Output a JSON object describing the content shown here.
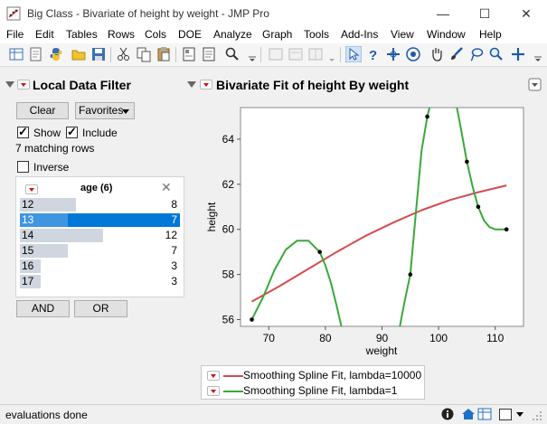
{
  "window": {
    "title": "Big Class - Bivariate of height by weight - JMP Pro"
  },
  "menu": [
    "File",
    "Edit",
    "Tables",
    "Rows",
    "Cols",
    "DOE",
    "Analyze",
    "Graph",
    "Tools",
    "Add-Ins",
    "View",
    "Window",
    "Help"
  ],
  "filter": {
    "header": "Local Data Filter",
    "clear_label": "Clear",
    "favorites_label": "Favorites",
    "show_label": "Show",
    "show_checked": true,
    "include_label": "Include",
    "include_checked": true,
    "matching": "7 matching rows",
    "inverse_label": "Inverse",
    "inverse_checked": false,
    "column_title": "age (6)",
    "rows": [
      {
        "label": "12",
        "count": "8",
        "fraction": 0.67,
        "selected": false
      },
      {
        "label": "13",
        "count": "7",
        "fraction": 0.58,
        "selected": true
      },
      {
        "label": "14",
        "count": "12",
        "fraction": 1.0,
        "selected": false
      },
      {
        "label": "15",
        "count": "7",
        "fraction": 0.58,
        "selected": false
      },
      {
        "label": "16",
        "count": "3",
        "fraction": 0.25,
        "selected": false
      },
      {
        "label": "17",
        "count": "3",
        "fraction": 0.25,
        "selected": false
      }
    ],
    "and_label": "AND",
    "or_label": "OR"
  },
  "report": {
    "header": "Bivariate Fit of height By weight"
  },
  "chart_data": {
    "type": "scatter",
    "xlabel": "weight",
    "ylabel": "height",
    "xlim": [
      65,
      115
    ],
    "ylim": [
      55.7,
      65.4
    ],
    "xticks": [
      "70",
      "80",
      "90",
      "100",
      "110"
    ],
    "yticks": [
      "56",
      "58",
      "60",
      "62",
      "64"
    ],
    "points": [
      [
        67,
        56
      ],
      [
        79,
        59
      ],
      [
        95,
        58
      ],
      [
        98,
        65
      ],
      [
        105,
        63
      ],
      [
        107,
        61
      ],
      [
        112,
        60
      ]
    ],
    "series": [
      {
        "name": "Smoothing Spline Fit, lambda=10000",
        "color": "#d64a52",
        "points": [
          [
            67,
            56.8
          ],
          [
            72,
            57.5
          ],
          [
            77,
            58.25
          ],
          [
            82,
            59.0
          ],
          [
            87,
            59.7
          ],
          [
            92,
            60.3
          ],
          [
            97,
            60.85
          ],
          [
            102,
            61.3
          ],
          [
            107,
            61.65
          ],
          [
            112,
            61.95
          ]
        ]
      },
      {
        "name": "Smoothing Spline Fit, lambda=1",
        "color": "#3aa83a",
        "points": [
          [
            67,
            56.0
          ],
          [
            69,
            57.0
          ],
          [
            71,
            58.2
          ],
          [
            73,
            59.1
          ],
          [
            75,
            59.5
          ],
          [
            77,
            59.5
          ],
          [
            79,
            59.0
          ],
          [
            80,
            58.4
          ],
          [
            81,
            57.6
          ],
          [
            82,
            56.6
          ],
          [
            83,
            55.5
          ],
          [
            84,
            54.4
          ],
          [
            92,
            54.4
          ],
          [
            93,
            55.5
          ],
          [
            94,
            56.8
          ],
          [
            95,
            58.0
          ],
          [
            96,
            60.8
          ],
          [
            97,
            63.5
          ],
          [
            98,
            65.0
          ],
          [
            99,
            66.0
          ],
          [
            100,
            66.6
          ],
          [
            101,
            67.0
          ],
          [
            102,
            66.6
          ],
          [
            103,
            65.7
          ],
          [
            104,
            64.4
          ],
          [
            105,
            63.0
          ],
          [
            106,
            61.9
          ],
          [
            107,
            61.0
          ],
          [
            108,
            60.4
          ],
          [
            109,
            60.1
          ],
          [
            110,
            60.0
          ],
          [
            112,
            60.0
          ]
        ]
      }
    ]
  },
  "status": {
    "text": "evaluations done"
  },
  "colors": {
    "selection": "#0078d7",
    "bar": "#cfd6df"
  }
}
